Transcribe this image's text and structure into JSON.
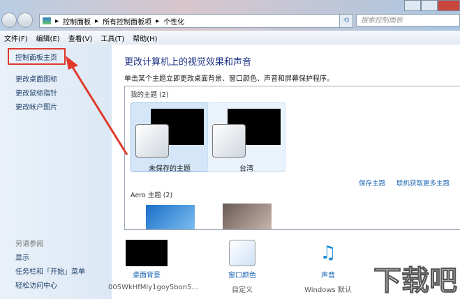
{
  "address": {
    "crumbs": [
      "控制面板",
      "所有控制面板项",
      "个性化"
    ],
    "search_placeholder": "搜索控制面板"
  },
  "menu": [
    "文件(F)",
    "编辑(E)",
    "查看(V)",
    "工具(T)",
    "帮助(H)"
  ],
  "sidebar": {
    "items": [
      "控制面板主页",
      "更改桌面图标",
      "更改鼠标指针",
      "更改帐户图片"
    ],
    "see_also_title": "另请参阅",
    "see_also": [
      "显示",
      "任务栏和「开始」菜单",
      "轻松访问中心"
    ]
  },
  "main": {
    "title": "更改计算机上的视觉效果和声音",
    "description": "单击某个主题立即更改桌面背景、窗口颜色、声音和屏幕保护程序。",
    "my_themes_label": "我的主题 (2)",
    "themes": [
      "未保存的主题",
      "台湾"
    ],
    "save_theme": "保存主题",
    "get_more": "联机获取更多主题",
    "aero_label": "Aero 主题 (2)"
  },
  "bottom": [
    {
      "label": "桌面背景",
      "sub": "005WkHfMly1goy5bon5..."
    },
    {
      "label": "窗口颜色",
      "sub": "自定义"
    },
    {
      "label": "声音",
      "sub": "Windows 默认"
    }
  ],
  "watermark": "下载吧"
}
